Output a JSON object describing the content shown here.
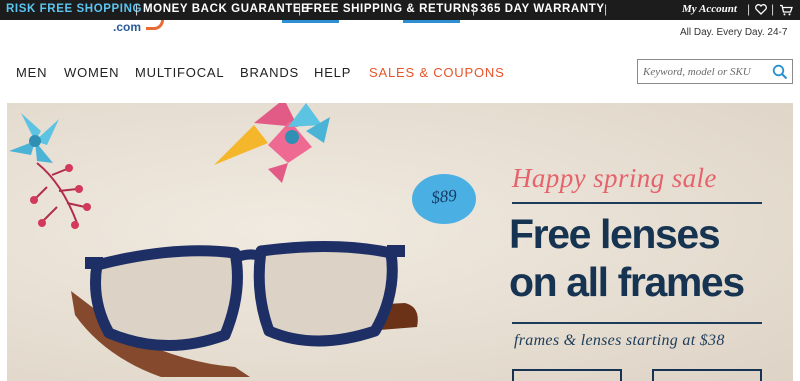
{
  "promo_bar": {
    "items": [
      "RISK FREE SHOPPING",
      "MONEY BACK GUARANTEE",
      "FREE SHIPPING & RETURNS",
      "365 DAY WARRANTY"
    ],
    "account_label": "My Account",
    "icons": [
      "heart-icon",
      "cart-icon"
    ]
  },
  "header": {
    "logo_fragment": ".com",
    "tagline": "All Day. Every Day. 24-7"
  },
  "nav": {
    "items": [
      "MEN",
      "WOMEN",
      "MULTIFOCAL",
      "BRANDS",
      "HELP",
      "SALES & COUPONS"
    ]
  },
  "search": {
    "placeholder": "Keyword, model or SKU",
    "value": "",
    "icon": "search-icon"
  },
  "hero": {
    "price_tag": "$89",
    "sale_title": "Happy spring sale",
    "headline_line1": "Free lenses",
    "headline_line2": "on all frames",
    "subline": "frames & lenses starting at $38",
    "buttons": [
      "",
      ""
    ]
  },
  "colors": {
    "promo_bar_bg": "#1c1c1c",
    "promo_highlight": "#5bc4f0",
    "sale_link": "#e8542a",
    "headline": "#163451",
    "sale_title": "#e5636b",
    "price_tag": "#4ab0e4"
  }
}
